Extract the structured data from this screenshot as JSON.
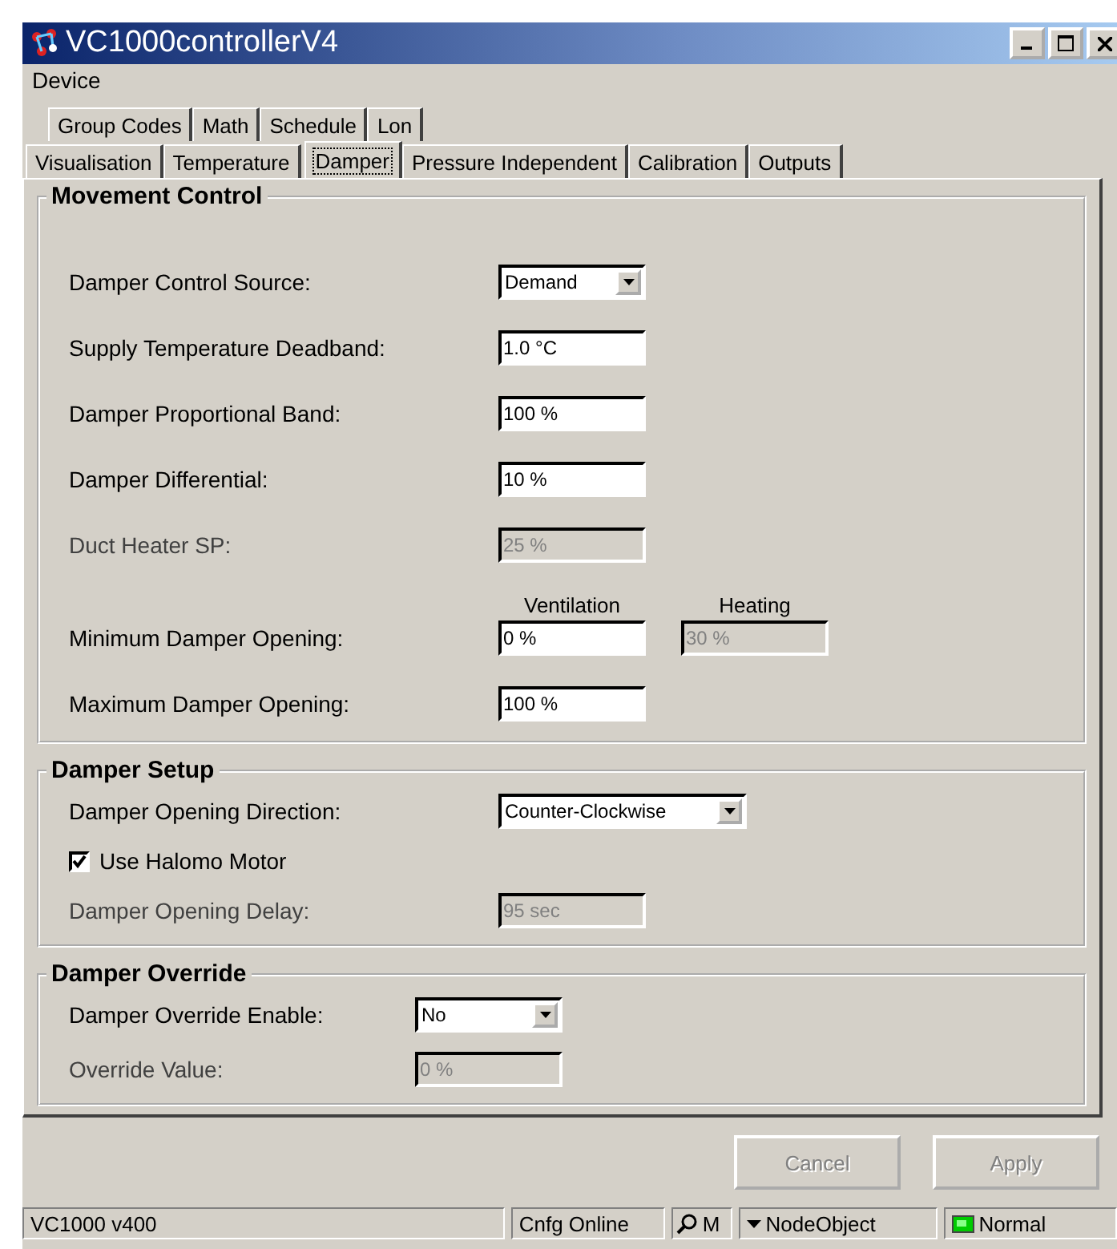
{
  "window": {
    "title": "VC1000controllerV4"
  },
  "menu": [
    "Device"
  ],
  "tab_rows": [
    [
      {
        "label": "Group Codes",
        "selected": false
      },
      {
        "label": "Math",
        "selected": false
      },
      {
        "label": "Schedule",
        "selected": false
      },
      {
        "label": "Lon",
        "selected": false
      }
    ],
    [
      {
        "label": "Visualisation",
        "selected": false
      },
      {
        "label": "Temperature",
        "selected": false
      },
      {
        "label": "Damper",
        "selected": true
      },
      {
        "label": "Pressure Independent",
        "selected": false
      },
      {
        "label": "Calibration",
        "selected": false
      },
      {
        "label": "Outputs",
        "selected": false
      }
    ]
  ],
  "groups": [
    {
      "title": "Movement Control",
      "fields": [
        {
          "kind": "dropdown",
          "label": "Damper Control Source:",
          "value": "Demand",
          "disabled": false
        },
        {
          "kind": "text",
          "label": "Supply Temperature Deadband:",
          "value": "1.0 °C",
          "disabled": false
        },
        {
          "kind": "text",
          "label": "Damper Proportional Band:",
          "value": "100 %",
          "disabled": false
        },
        {
          "kind": "text",
          "label": "Damper Differential:",
          "value": "10 %",
          "disabled": false
        },
        {
          "kind": "text",
          "label": "Duct Heater SP:",
          "value": "25 %",
          "disabled": true
        },
        {
          "kind": "pair",
          "label": "Minimum Damper Opening:",
          "values": [
            {
              "header": "Ventilation",
              "value": "0 %",
              "disabled": false
            },
            {
              "header": "Heating",
              "value": "30 %",
              "disabled": true
            }
          ]
        },
        {
          "kind": "text",
          "label": "Maximum Damper Opening:",
          "value": "100 %",
          "disabled": false
        }
      ]
    },
    {
      "title": "Damper Setup",
      "fields": [
        {
          "kind": "dropdown",
          "label": "Damper Opening Direction:",
          "value": "Counter-Clockwise",
          "disabled": false
        },
        {
          "kind": "checkbox",
          "label": "Use Halomo Motor",
          "checked": true
        },
        {
          "kind": "text",
          "label": "Damper Opening Delay:",
          "value": "95 sec",
          "disabled": true
        }
      ]
    },
    {
      "title": "Damper Override",
      "fields": [
        {
          "kind": "dropdown",
          "label": "Damper Override Enable:",
          "value": "No",
          "disabled": false
        },
        {
          "kind": "text",
          "label": "Override Value:",
          "value": "0 %",
          "disabled": true
        }
      ]
    }
  ],
  "buttons": [
    {
      "label": "Cancel",
      "disabled": true
    },
    {
      "label": "Apply",
      "disabled": true
    }
  ],
  "status_bar": [
    {
      "kind": "plain",
      "text": "VC1000 v400"
    },
    {
      "kind": "plain",
      "text": "Cnfg Online"
    },
    {
      "kind": "search",
      "text": "M"
    },
    {
      "kind": "dropdown",
      "text": "NodeObject"
    },
    {
      "kind": "led",
      "text": "Normal"
    }
  ]
}
